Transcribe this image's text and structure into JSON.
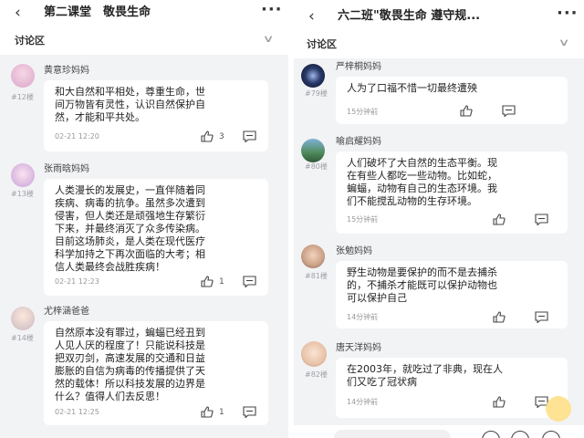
{
  "left": {
    "title": "第二课堂　敬畏生命",
    "section": "讨论区",
    "comments": [
      {
        "user": "黄意珍妈妈",
        "floor": "#12楼",
        "lines": [
          "和大自然和平相处，尊重生命，世",
          "间万物皆有灵性，认识自然保护自",
          "然，才能和平共处。"
        ],
        "time": "02-21 12:20",
        "likes": "3"
      },
      {
        "user": "张雨晗妈妈",
        "floor": "#13楼",
        "lines": [
          "人类漫长的发展史，一直伴随着同",
          "疾病、病毒的抗争。虽然多次遭到",
          "侵害，但人类还是顽强地生存繁衍",
          "下来，并最终消灭了众多传染病。",
          "目前这场肺炎，是人类在现代医疗",
          "科学加持之下再次面临的大考；相",
          "信人类最终会战胜疾病！"
        ],
        "time": "02-21 12:23",
        "likes": "1"
      },
      {
        "user": "尤梓涵爸爸",
        "floor": "#14楼",
        "lines": [
          "自然原本没有罪过，蝙蝠已经丑到",
          "人见人厌的程度了！只能说科技是",
          "把双刃剑，高速发展的交通和日益",
          "膨胀的自信为病毒的传播提供了天",
          "然的载体！所以科技发展的边界是",
          "什么？值得人们去反思！"
        ],
        "time": "02-21 12:25",
        "likes": "1"
      }
    ]
  },
  "right": {
    "title": "六二班\"敬畏生命 遵守规...",
    "section": "讨论区",
    "comments": [
      {
        "user": "严梓桐妈妈",
        "floor": "#79楼",
        "lines": [
          "人为了口福不惜一切最终遭殃"
        ],
        "time": "15分钟前"
      },
      {
        "user": "喻启耀妈妈",
        "floor": "#80楼",
        "lines": [
          "人们破坏了大自然的生态平衡。现",
          "在有些人都吃一些动物。比如蛇，",
          "蝙蝠，动物有自己的生态环境。我",
          "们不能搅乱动物的生存环境。"
        ],
        "time": "15分钟前"
      },
      {
        "user": "张勉妈妈",
        "floor": "#81楼",
        "lines": [
          "野生动物是要保护的而不是去捕杀",
          "的，不捕杀才能既可以保护动物也",
          "可以保护自己"
        ],
        "time": "14分钟前"
      },
      {
        "user": "唐天洋妈妈",
        "floor": "#82楼",
        "lines": [
          "在2003年，就吃过了非典，现在人",
          "们又吃了冠状病"
        ],
        "time": "14分钟前"
      }
    ]
  },
  "icons": {
    "back": "back-arrow-icon",
    "more": "more-dots-icon",
    "chevron": "chevron-down-icon",
    "like": "thumbs-up-icon",
    "comment": "comment-icon"
  },
  "colors": {
    "background": "#f2f3f5",
    "card": "#ffffff",
    "floor_label": "#a0a0a8"
  }
}
